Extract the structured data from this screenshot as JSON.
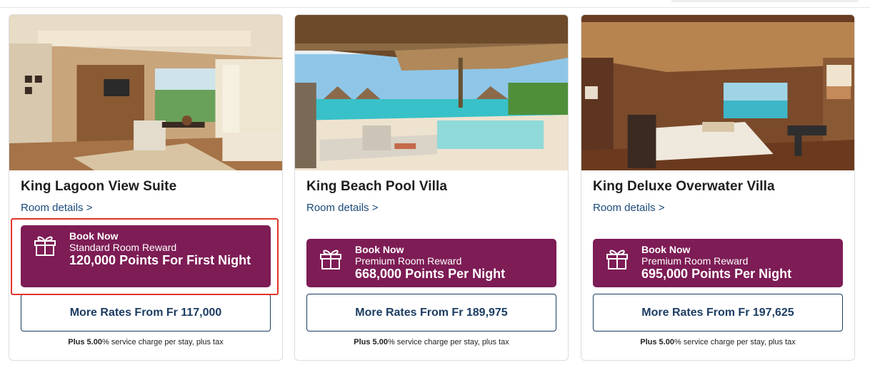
{
  "rooms": [
    {
      "name": "King Lagoon View Suite",
      "details_link": "Room details >",
      "reward": {
        "book_now": "Book Now",
        "tier": "Standard Room Reward",
        "points": "120,000 Points For First Night"
      },
      "more_rates": "More Rates From Fr 117,000",
      "fee_prefix": "Plus",
      "fee_percent": "5.00",
      "fee_suffix": "% service charge per stay, plus tax"
    },
    {
      "name": "King Beach Pool Villa",
      "details_link": "Room details >",
      "reward": {
        "book_now": "Book Now",
        "tier": "Premium Room Reward",
        "points": "668,000 Points Per Night"
      },
      "more_rates": "More Rates From Fr 189,975",
      "fee_prefix": "Plus",
      "fee_percent": "5.00",
      "fee_suffix": "% service charge per stay, plus tax"
    },
    {
      "name": "King Deluxe Overwater Villa",
      "details_link": "Room details >",
      "reward": {
        "book_now": "Book Now",
        "tier": "Premium Room Reward",
        "points": "695,000 Points Per Night"
      },
      "more_rates": "More Rates From Fr 197,625",
      "fee_prefix": "Plus",
      "fee_percent": "5.00",
      "fee_suffix": "% service charge per stay, plus tax"
    }
  ],
  "icons": {
    "reward": "gift-icon"
  },
  "colors": {
    "reward_bg": "#7d1c55",
    "link": "#1c4a7a",
    "button_border": "#1c3d63",
    "highlight": "#e0352b"
  }
}
